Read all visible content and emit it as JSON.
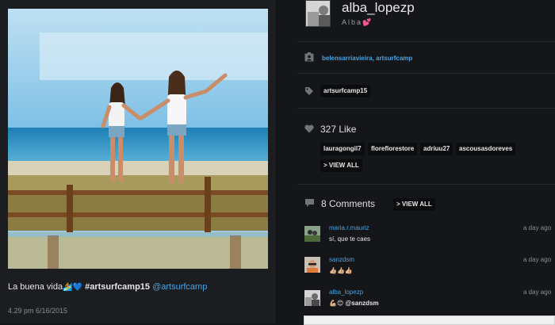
{
  "post": {
    "caption_text": "La buena vida",
    "caption_emoji": "🏄💙",
    "caption_hashtag": "#artsurfcamp15",
    "caption_mention": "@artsurfcamp",
    "timestamp": "4.29 pm 6/16/2015"
  },
  "profile": {
    "username": "alba_lopezp",
    "fullname": "Alba",
    "fullname_emoji": "💕"
  },
  "tagged": {
    "users": "belensarriavieira, artsurfcamp"
  },
  "hashtags": [
    "artsurfcamp15"
  ],
  "likes": {
    "count_label": "327 Like",
    "users": [
      "lauragongil7",
      "floreflorestore",
      "adriuu27",
      "ascousasdoreves"
    ],
    "view_all": "> VIEW ALL"
  },
  "comments": {
    "count_label": "8 Comments",
    "view_all": "> VIEW ALL",
    "items": [
      {
        "user": "maria.r.mauriz",
        "text": "sí, que te caes",
        "time": "a day ago"
      },
      {
        "user": "sanzdsm",
        "text": "👍🏼👍🏼👍🏼",
        "time": "a day ago"
      },
      {
        "user": "alba_lopezp",
        "text": "💪🏼😊",
        "mention": "@sanzdsm",
        "time": "a day ago"
      }
    ]
  },
  "icons": {
    "tagged": "person-badge-icon",
    "hashtag": "tag-icon",
    "likes": "heart-icon",
    "comments": "speech-bubble-icon"
  },
  "colors": {
    "link": "#4aa3df",
    "background": "#141619",
    "chip_background": "#0b0c0e"
  }
}
